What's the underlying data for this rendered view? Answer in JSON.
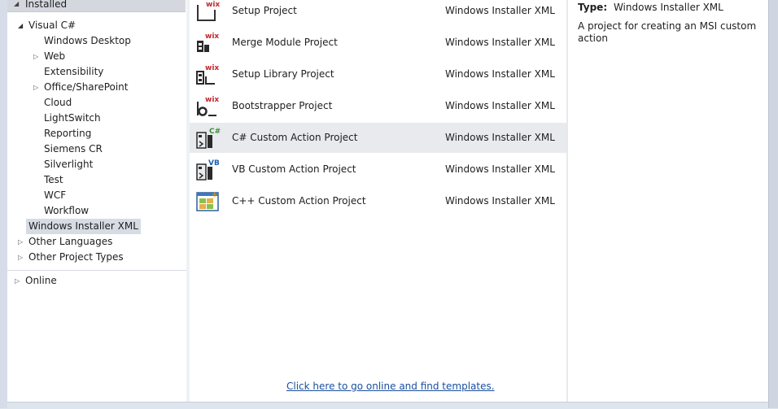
{
  "tree": {
    "installed_label": "Installed",
    "items": [
      {
        "label": "Visual C#",
        "expander": "open"
      },
      {
        "label": "Windows Desktop",
        "expander": "none"
      },
      {
        "label": "Web",
        "expander": "closed"
      },
      {
        "label": "Extensibility",
        "expander": "none"
      },
      {
        "label": "Office/SharePoint",
        "expander": "closed"
      },
      {
        "label": "Cloud",
        "expander": "none"
      },
      {
        "label": "LightSwitch",
        "expander": "none"
      },
      {
        "label": "Reporting",
        "expander": "none"
      },
      {
        "label": "Siemens CR",
        "expander": "none"
      },
      {
        "label": "Silverlight",
        "expander": "none"
      },
      {
        "label": "Test",
        "expander": "none"
      },
      {
        "label": "WCF",
        "expander": "none"
      },
      {
        "label": "Workflow",
        "expander": "none"
      },
      {
        "label": "Windows Installer XML",
        "expander": "none",
        "selected": true
      },
      {
        "label": "Other Languages",
        "expander": "closed"
      },
      {
        "label": "Other Project Types",
        "expander": "closed"
      }
    ],
    "online_label": "Online"
  },
  "templates": {
    "rows": [
      {
        "name": "Setup Project",
        "type": "Windows Installer XML",
        "icon": "wix-setup-icon"
      },
      {
        "name": "Merge Module Project",
        "type": "Windows Installer XML",
        "icon": "wix-merge-module-icon"
      },
      {
        "name": "Setup Library Project",
        "type": "Windows Installer XML",
        "icon": "wix-setup-library-icon"
      },
      {
        "name": "Bootstrapper Project",
        "type": "Windows Installer XML",
        "icon": "wix-bootstrapper-icon"
      },
      {
        "name": "C# Custom Action Project",
        "type": "Windows Installer XML",
        "icon": "csharp-custom-action-icon",
        "selected": true
      },
      {
        "name": "VB Custom Action Project",
        "type": "Windows Installer XML",
        "icon": "vb-custom-action-icon"
      },
      {
        "name": "C++ Custom Action Project",
        "type": "Windows Installer XML",
        "icon": "cpp-custom-action-icon"
      }
    ],
    "online_link": "Click here to go online and find templates."
  },
  "details": {
    "type_key": "Type:",
    "type_value": "Windows Installer XML",
    "description": "A project for creating an MSI custom action"
  },
  "colors": {
    "wix_red": "#c0282d",
    "csharp_green": "#3a8f3a",
    "vb_blue": "#1f5fae",
    "selection": "#e8eaed",
    "link": "#1a4fa0"
  }
}
